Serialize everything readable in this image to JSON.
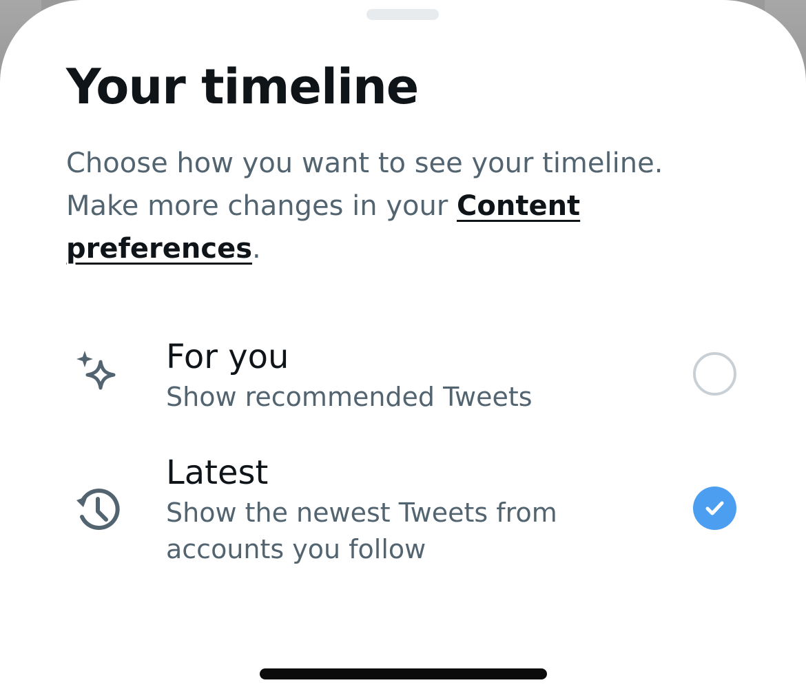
{
  "sheet": {
    "title": "Your timeline",
    "description_prefix": "Choose how you want to see your timeline. Make more changes in your ",
    "description_link": "Content preferences",
    "description_suffix": "."
  },
  "options": [
    {
      "label": "For you",
      "sublabel": "Show recommended Tweets",
      "icon": "sparkle-icon",
      "selected": false
    },
    {
      "label": "Latest",
      "sublabel": "Show the newest Tweets from accounts you follow",
      "icon": "history-icon",
      "selected": true
    }
  ],
  "colors": {
    "accent": "#4c9ef0",
    "title_text": "#0f1419",
    "secondary_text": "#536471",
    "radio_unselected_border": "#c9d0d5"
  }
}
